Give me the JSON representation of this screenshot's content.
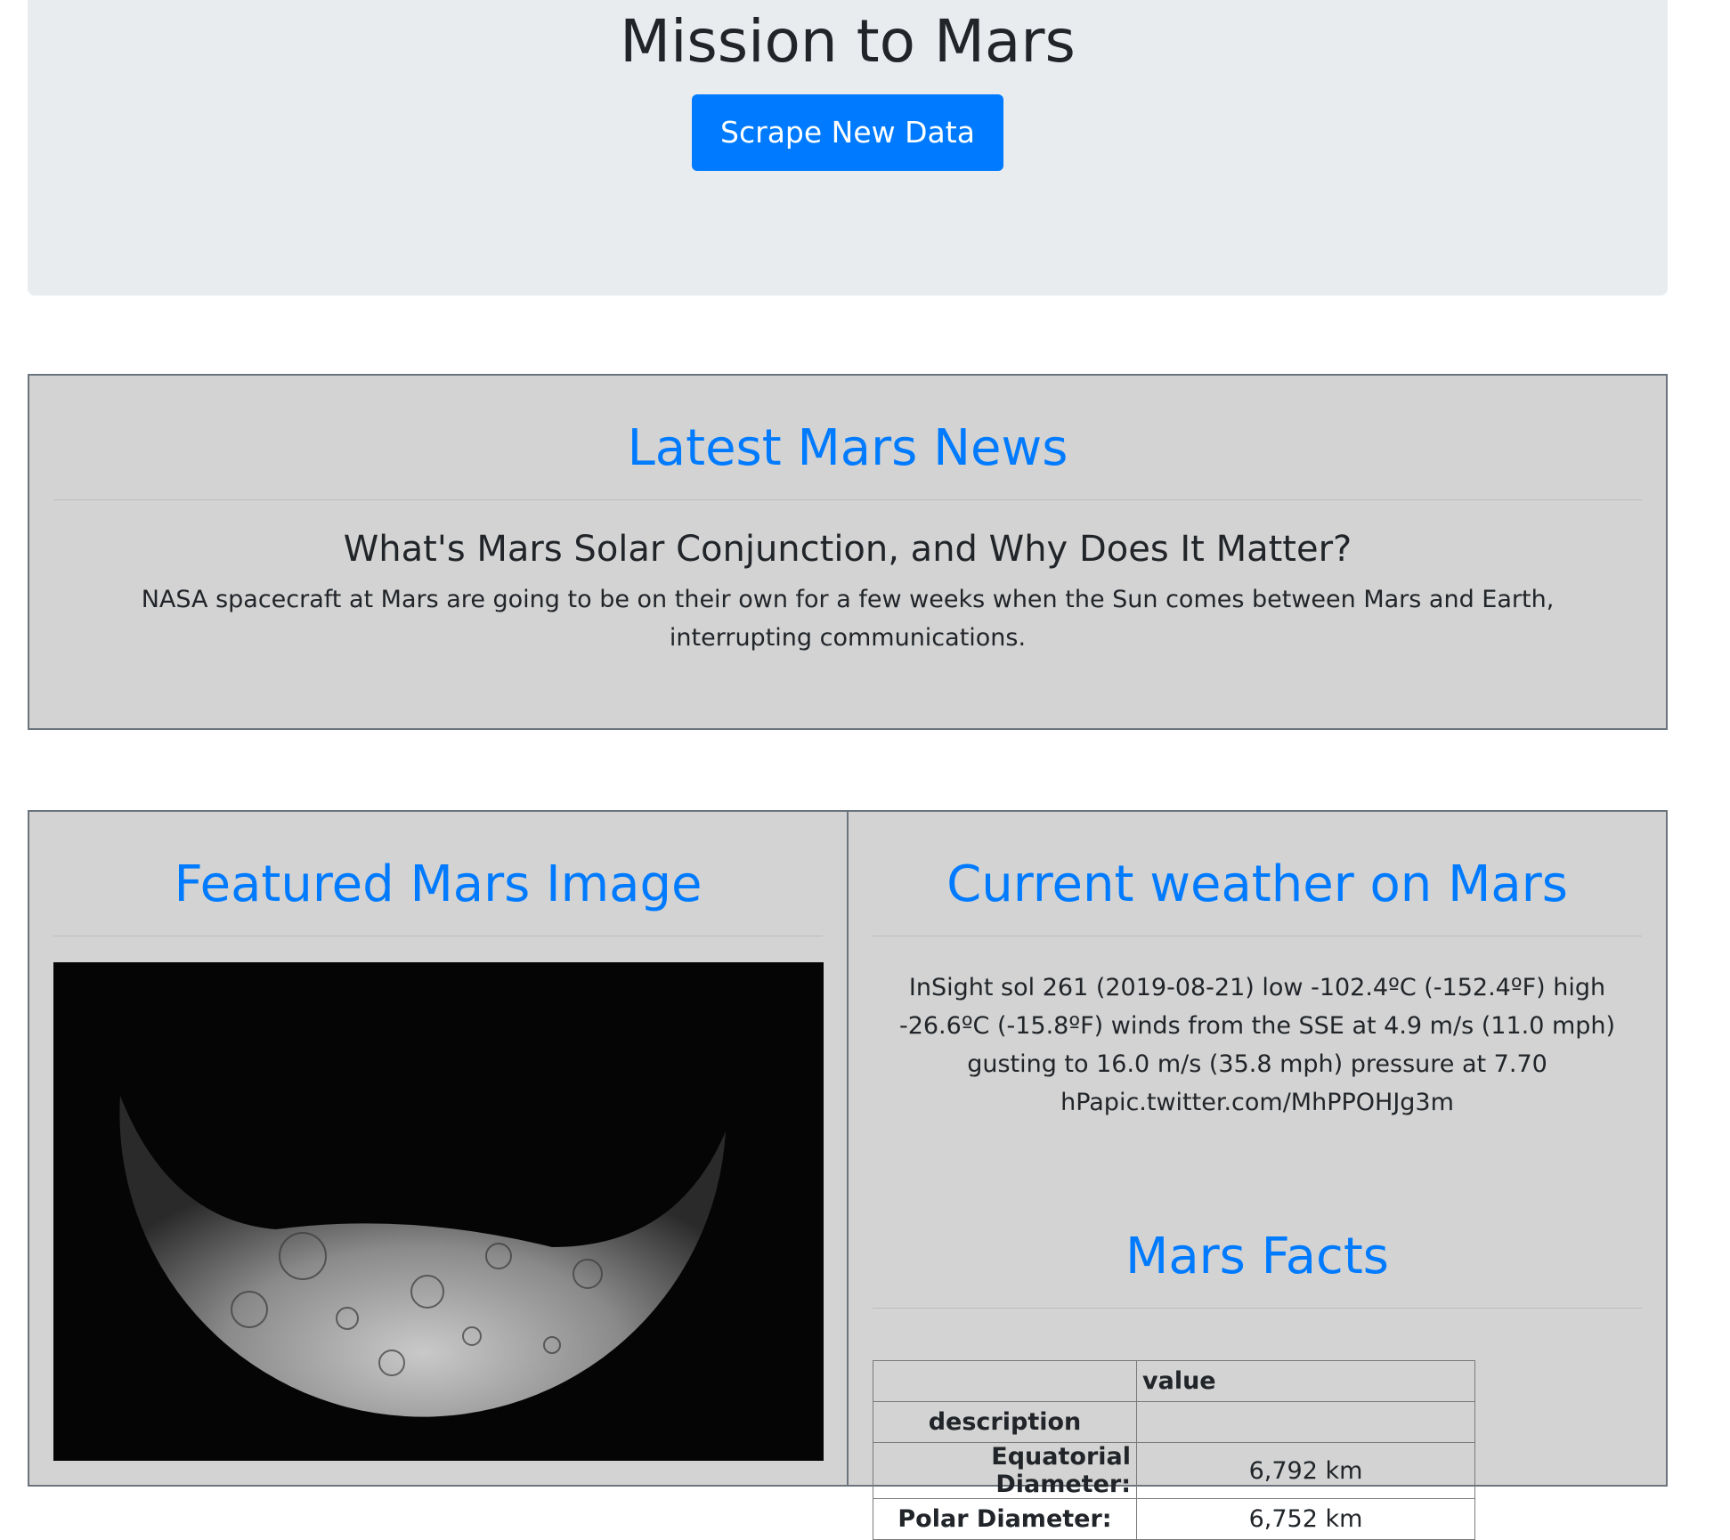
{
  "header": {
    "title": "Mission to Mars",
    "scrape_button": "Scrape New Data"
  },
  "news": {
    "heading": "Latest Mars News",
    "title": "What's Mars Solar Conjunction, and Why Does It Matter?",
    "paragraph": "NASA spacecraft at Mars are going to be on their own for a few weeks when the Sun comes between Mars and Earth, interrupting communications."
  },
  "featured": {
    "heading": "Featured Mars Image"
  },
  "weather": {
    "heading": "Current weather on Mars",
    "text": "InSight sol 261 (2019-08-21) low -102.4ºC (-152.4ºF) high -26.6ºC (-15.8ºF) winds from the SSE at 4.9 m/s (11.0 mph) gusting to 16.0 m/s (35.8 mph) pressure at 7.70 hPapic.twitter.com/MhPPOHJg3m"
  },
  "facts": {
    "heading": "Mars Facts",
    "column_header": "value",
    "index_header": "description",
    "rows": [
      {
        "key": "Equatorial Diameter:",
        "value": "6,792 km"
      },
      {
        "key": "Polar Diameter:",
        "value": "6,752 km"
      }
    ]
  }
}
